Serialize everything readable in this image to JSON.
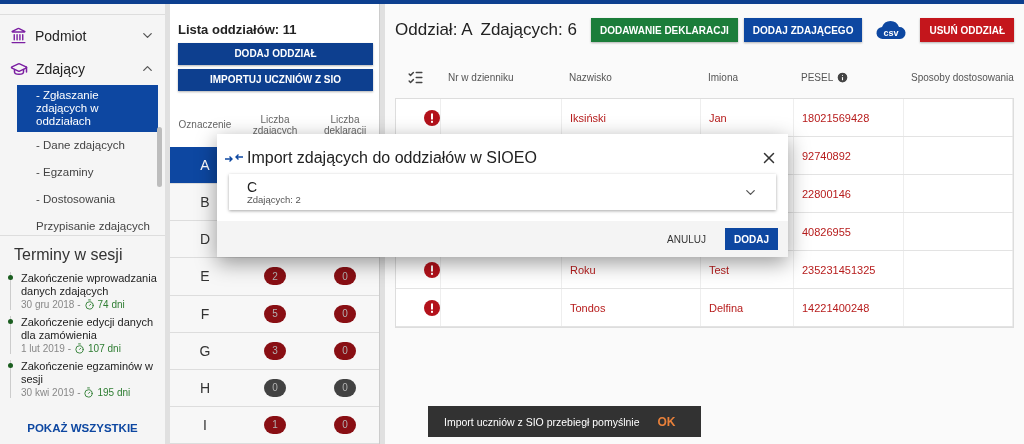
{
  "nav": [
    {
      "label": "Podmiot",
      "expanded": false
    },
    {
      "label": "Zdający",
      "expanded": true,
      "children": [
        {
          "label": "- Zgłaszanie zdających w oddziałach",
          "selected": true
        },
        {
          "label": "- Dane zdających",
          "selected": false
        },
        {
          "label": "- Egzaminy",
          "selected": false
        },
        {
          "label": "- Dostosowania",
          "selected": false
        },
        {
          "label": "Przypisanie zdających",
          "selected": false
        }
      ]
    }
  ],
  "deadlines": {
    "title": "Terminy w sesji",
    "items": [
      {
        "title": "Zakończenie wprowadzania danych zdających",
        "date": "30 gru 2018 -",
        "remaining": "74 dni"
      },
      {
        "title": "Zakończenie edycji danych dla zamówienia",
        "date": "1 lut 2019 -",
        "remaining": "107 dni"
      },
      {
        "title": "Zakończenie egzaminów w sesji",
        "date": "30 kwi 2019 -",
        "remaining": "195 dni"
      }
    ],
    "show_all": "POKAŻ WSZYSTKIE"
  },
  "classes": {
    "title": "Lista oddziałów: 11",
    "buttons": [
      "DODAJ ODDZIAŁ",
      "IMPORTUJ UCZNIÓW Z SIO"
    ],
    "columns": [
      "Oznaczenie",
      "Liczba zdających",
      "Liczba deklaracji"
    ],
    "rows": [
      {
        "label": "A",
        "selected": true
      },
      {
        "label": "B",
        "selected": false
      },
      {
        "label": "D",
        "selected": false
      },
      {
        "label": "E",
        "selected": false,
        "counts": [
          {
            "value": "2",
            "color": "#890f14"
          },
          {
            "value": "0",
            "color": "#890f14"
          }
        ]
      },
      {
        "label": "F",
        "selected": false,
        "counts": [
          {
            "value": "5",
            "color": "#890f14"
          },
          {
            "value": "0",
            "color": "#890f14"
          }
        ]
      },
      {
        "label": "G",
        "selected": false,
        "counts": [
          {
            "value": "3",
            "color": "#890f14"
          },
          {
            "value": "0",
            "color": "#890f14"
          }
        ]
      },
      {
        "label": "H",
        "selected": false,
        "counts": [
          {
            "value": "0",
            "color": "#424242"
          },
          {
            "value": "0",
            "color": "#424242"
          }
        ]
      },
      {
        "label": "I",
        "selected": false,
        "counts": [
          {
            "value": "1",
            "color": "#890f14"
          },
          {
            "value": "0",
            "color": "#890f14"
          }
        ]
      }
    ]
  },
  "detail": {
    "title": "Oddział: A",
    "count": "Zdających: 6",
    "actions": [
      {
        "label": "DODAWANIE DEKLARACJI",
        "kind": "success"
      },
      {
        "label": "DODAJ ZDAJĄCEGO",
        "kind": "primary"
      },
      {
        "label": "csv",
        "kind": "csv"
      },
      {
        "label": "USUŃ ODDZIAŁ",
        "kind": "danger"
      }
    ],
    "columns": [
      "Nr w dzienniku",
      "Nazwisko",
      "Imiona",
      "PESEL",
      "Sposoby dostosowania"
    ],
    "rows": [
      {
        "error": true,
        "surname": "Iksiński",
        "name": "Jan",
        "pesel": "18021569428"
      },
      {
        "pesel": "92740892"
      },
      {
        "pesel": "22800146"
      },
      {
        "pesel": "40826955"
      },
      {
        "error": true,
        "surname": "Roku",
        "name": "Test",
        "pesel": "235231451325"
      },
      {
        "error": true,
        "surname": "Tondos",
        "name": "Delfina",
        "pesel": "14221400248"
      }
    ]
  },
  "dialog": {
    "title": "Import zdających do oddziałów w SIOEO",
    "panel": {
      "title": "C",
      "subtitle": "Zdających: 2",
      "expanded": false
    },
    "buttons": [
      {
        "label": "ANULUJ",
        "kind": "text"
      },
      {
        "label": "DODAJ",
        "kind": "primary"
      }
    ]
  },
  "snackbar": {
    "message": "Import uczniów z SIO przebiegł pomyślnie",
    "action": "OK"
  }
}
